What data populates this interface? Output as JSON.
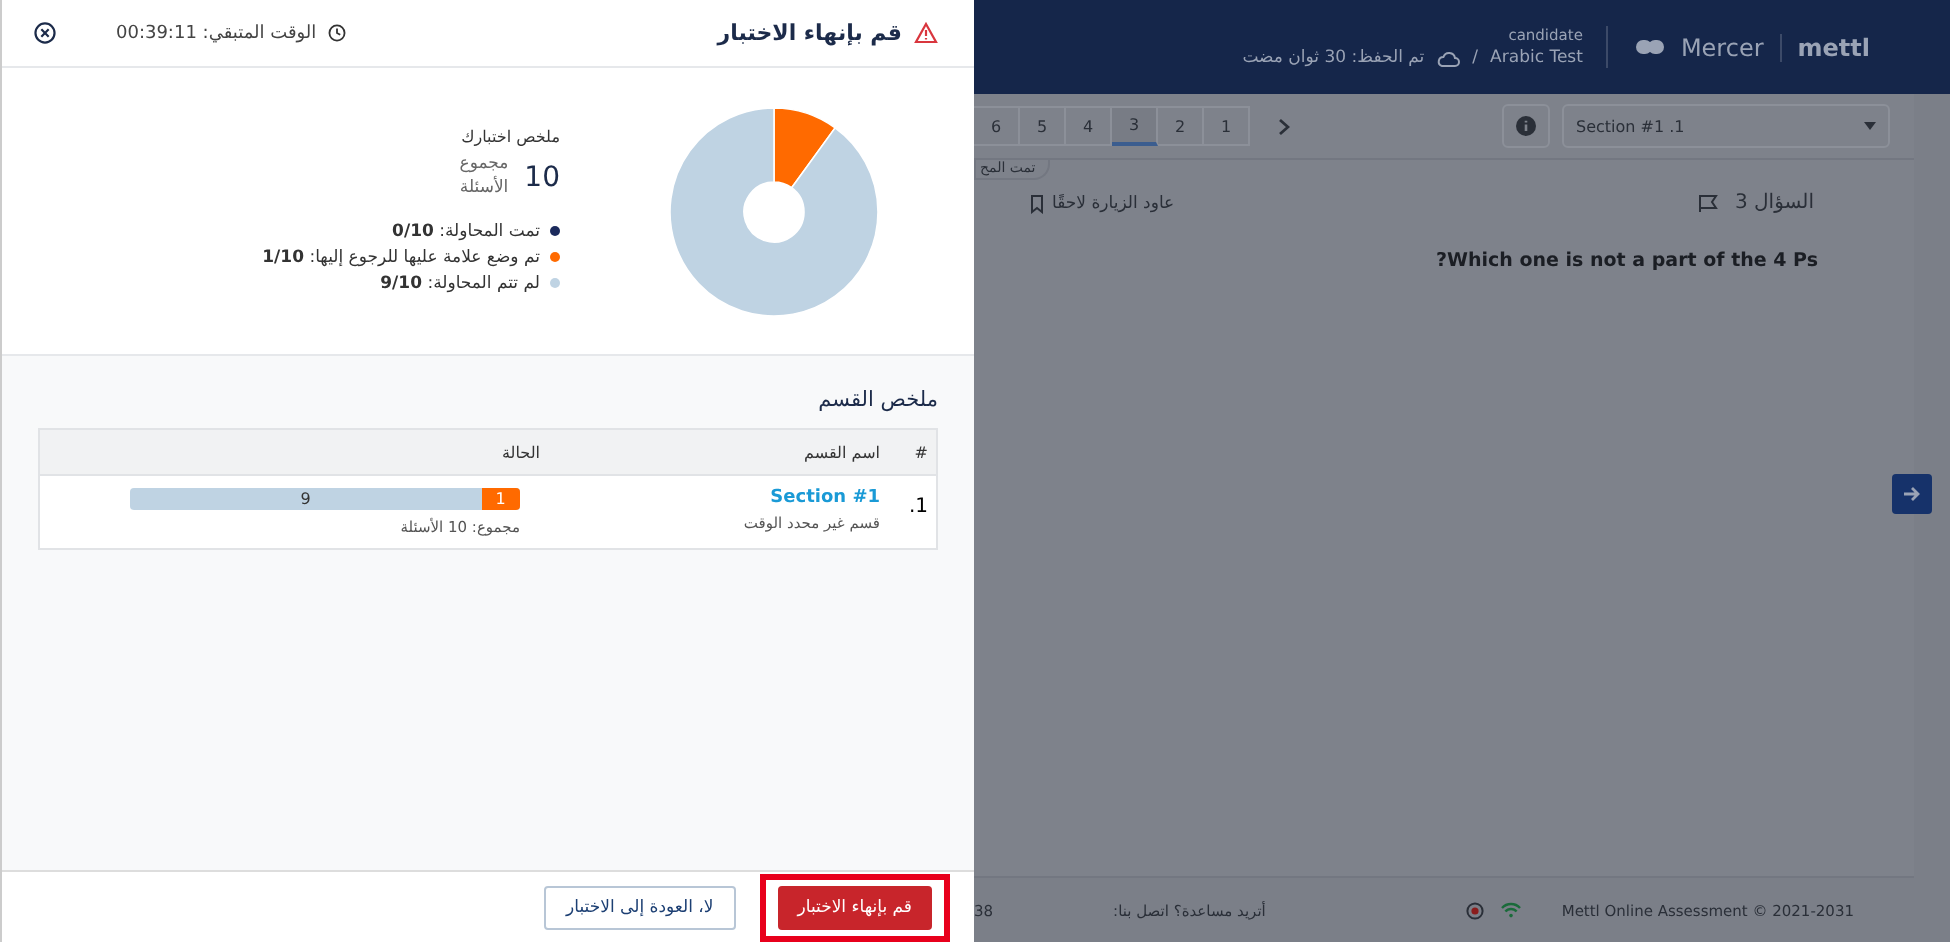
{
  "dialog": {
    "title": "قم بإنهاء الاختبار",
    "timer_label": "الوقت المتبقي:",
    "timer": "00:39:11",
    "summary": {
      "heading": "ملخص اختبارك",
      "total": "10",
      "total_label": "مجموع الأسئلة",
      "legend": [
        {
          "text": "تمت المحاولة: **0/10**",
          "color": "#1b2a5c"
        },
        {
          "text": "تم وضع علامة عليها للرجوع إليها: **1/10**",
          "color": "#ff6a00"
        },
        {
          "text": "لم تتم المحاولة: **9/10**",
          "color": "#bfd3e3"
        }
      ],
      "chart_data": {
        "type": "donut",
        "values": [
          0,
          10,
          90
        ]
      }
    },
    "section_summary": {
      "title": "ملخص القسم",
      "columns": [
        "#",
        "اسم القسم",
        "الحالة"
      ],
      "rows": [
        {
          "index": "1.",
          "name": "Section #1",
          "subtitle": "قسم غير محدد الوقت",
          "total": "مجموع: 10 الأسئلة",
          "progress": {
            "level": 0.1,
            "fill_label": "1",
            "rest_label": "9"
          }
        }
      ]
    },
    "buttons": [
      {
        "label": "قم بإنهاء الاختبار",
        "kind": "primary",
        "highlighted": true
      },
      {
        "label": "لا، العودة إلى الاختبار",
        "kind": "secondary",
        "highlighted": false
      }
    ]
  },
  "background": {
    "logo_left": "Mercer",
    "logo_right": "mettl",
    "role": "candidate",
    "test_name": "Arabic Test",
    "separator": "/",
    "saved": "تم الحفظ: 30 ثوان مضت",
    "section_select": "Section #1 .1",
    "question_tabs": [
      {
        "label": "1",
        "selected": false
      },
      {
        "label": "2",
        "selected": false
      },
      {
        "label": "3",
        "selected": true
      },
      {
        "label": "4",
        "selected": false
      },
      {
        "label": "5",
        "selected": false
      },
      {
        "label": "6",
        "selected": false
      }
    ],
    "status_tag": "تمت المح",
    "question_label": "السؤال 3",
    "revisit": "عاود الزيارة لاحقًا",
    "question": "?Which one is not a part of the 4 Ps",
    "footer": {
      "copyright": "Mettl Online Assessment © 2021-2031",
      "help": "أتريد مساعدة؟ اتصل بنا:",
      "phone": "38"
    }
  }
}
